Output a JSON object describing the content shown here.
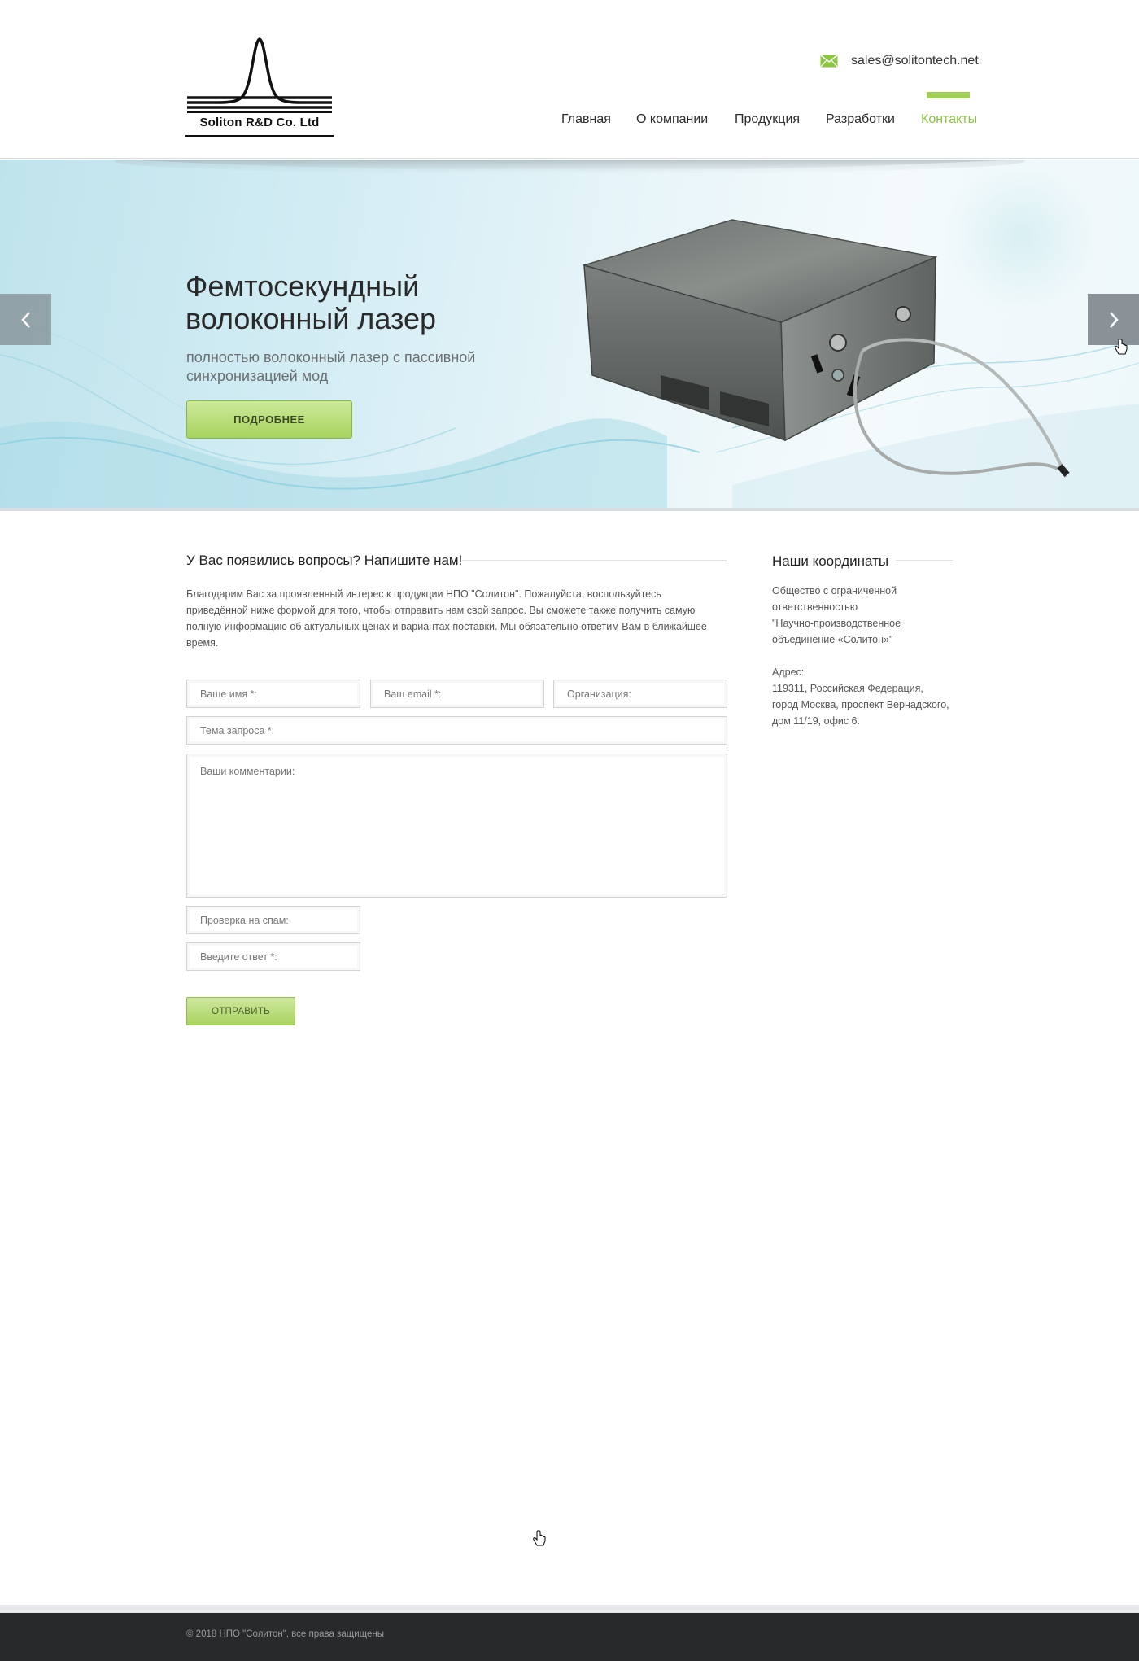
{
  "header": {
    "logo_text": "Soliton R&D Co. Ltd",
    "email": "sales@solitontech.net",
    "nav": [
      {
        "label": "Главная",
        "active": false
      },
      {
        "label": "О компании",
        "active": false
      },
      {
        "label": "Продукция",
        "active": false
      },
      {
        "label": "Разработки",
        "active": false
      },
      {
        "label": "Контакты",
        "active": true
      }
    ],
    "accent_color": "#8cc540"
  },
  "slider": {
    "title": "Фемтосекундный волоконный лазер",
    "subtitle": "полностью волоконный лазер с пассивной синхронизацией мод",
    "button_label": "ПОДРОБНЕЕ",
    "prev_icon": "chevron-left-icon",
    "next_icon": "chevron-right-icon"
  },
  "contact_form": {
    "title": "У Вас появились вопросы? Напишите нам!",
    "intro": "Благодарим Вас за проявленный интерес к продукции НПО \"Солитон\". Пожалуйста, воспользуйтесь приведённой ниже формой для того, чтобы отправить нам свой запрос. Вы сможете также получить самую полную информацию об актуальных ценах и вариантах поставки. Мы обязательно ответим Вам в ближайшее время.",
    "name_placeholder": "Ваше имя *:",
    "email_placeholder": "Ваш email *:",
    "org_placeholder": "Организация:",
    "subject_placeholder": "Тема запроса *:",
    "comments_placeholder": "Ваши комментарии:",
    "spam_check_placeholder": "Проверка на спам:",
    "answer_placeholder": "Введите ответ *:",
    "submit_label": "ОТПРАВИТЬ"
  },
  "coordinates": {
    "title": "Наши координаты",
    "company_lines": [
      "Общество с ограниченной",
      "ответственностью",
      "\"Научно-производственное",
      "объединение «Солитон»\""
    ],
    "address_label": "Адрес:",
    "address_lines": [
      "119311, Российская Федерация,",
      "город Москва, проспект Вернадского,",
      "дом 11/19, офис 6."
    ]
  },
  "footer": {
    "copyright": "© 2018 НПО \"Солитон\", все права защищены"
  }
}
